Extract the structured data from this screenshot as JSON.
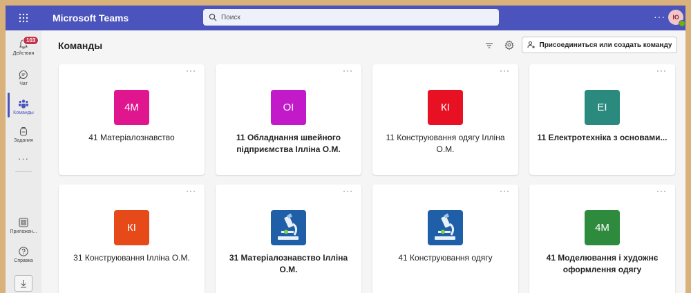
{
  "app": {
    "title": "Microsoft Teams"
  },
  "search": {
    "placeholder": "Поиск"
  },
  "user": {
    "initials": "Ю"
  },
  "rail": {
    "activity": {
      "label": "Действия",
      "badge": "103"
    },
    "chat": {
      "label": "Чат"
    },
    "teams": {
      "label": "Команды"
    },
    "assignments": {
      "label": "Задания"
    },
    "apps": {
      "label": "Приложен..."
    },
    "help": {
      "label": "Справка"
    }
  },
  "header": {
    "title": "Команды",
    "join_label": "Присоединиться или создать команду"
  },
  "colors": {
    "brand": "#4b53bc",
    "badge": "#c4314b"
  },
  "teams": [
    {
      "name": "41 Матеріалознавство",
      "initials": "4М",
      "color": "#e0168f",
      "bold": false
    },
    {
      "name": "11 Обладнання швейного підприємства Ілліна О.М.",
      "initials": "ОІ",
      "color": "#c219c9",
      "bold": true
    },
    {
      "name": "11 Конструювання одягу Ілліна О.М.",
      "initials": "КІ",
      "color": "#e81123",
      "bold": false
    },
    {
      "name": "11 Електротехніка з основами...",
      "initials": "ЕІ",
      "color": "#2b8a7e",
      "bold": true
    },
    {
      "name": "31 Конструювання Ілліна О.М.",
      "initials": "КІ",
      "color": "#e64a19",
      "bold": false
    },
    {
      "name": "31 Матеріалознавство Ілліна О.М.",
      "initials": "",
      "icon": "microscope-icon",
      "color": "#1f5fa8",
      "bold": true
    },
    {
      "name": "41 Конструювання одягу",
      "initials": "",
      "icon": "microscope-icon",
      "color": "#1f5fa8",
      "bold": false
    },
    {
      "name": "41 Моделювання і художнє оформлення одягу",
      "initials": "4М",
      "color": "#2e8b3e",
      "bold": true
    }
  ]
}
